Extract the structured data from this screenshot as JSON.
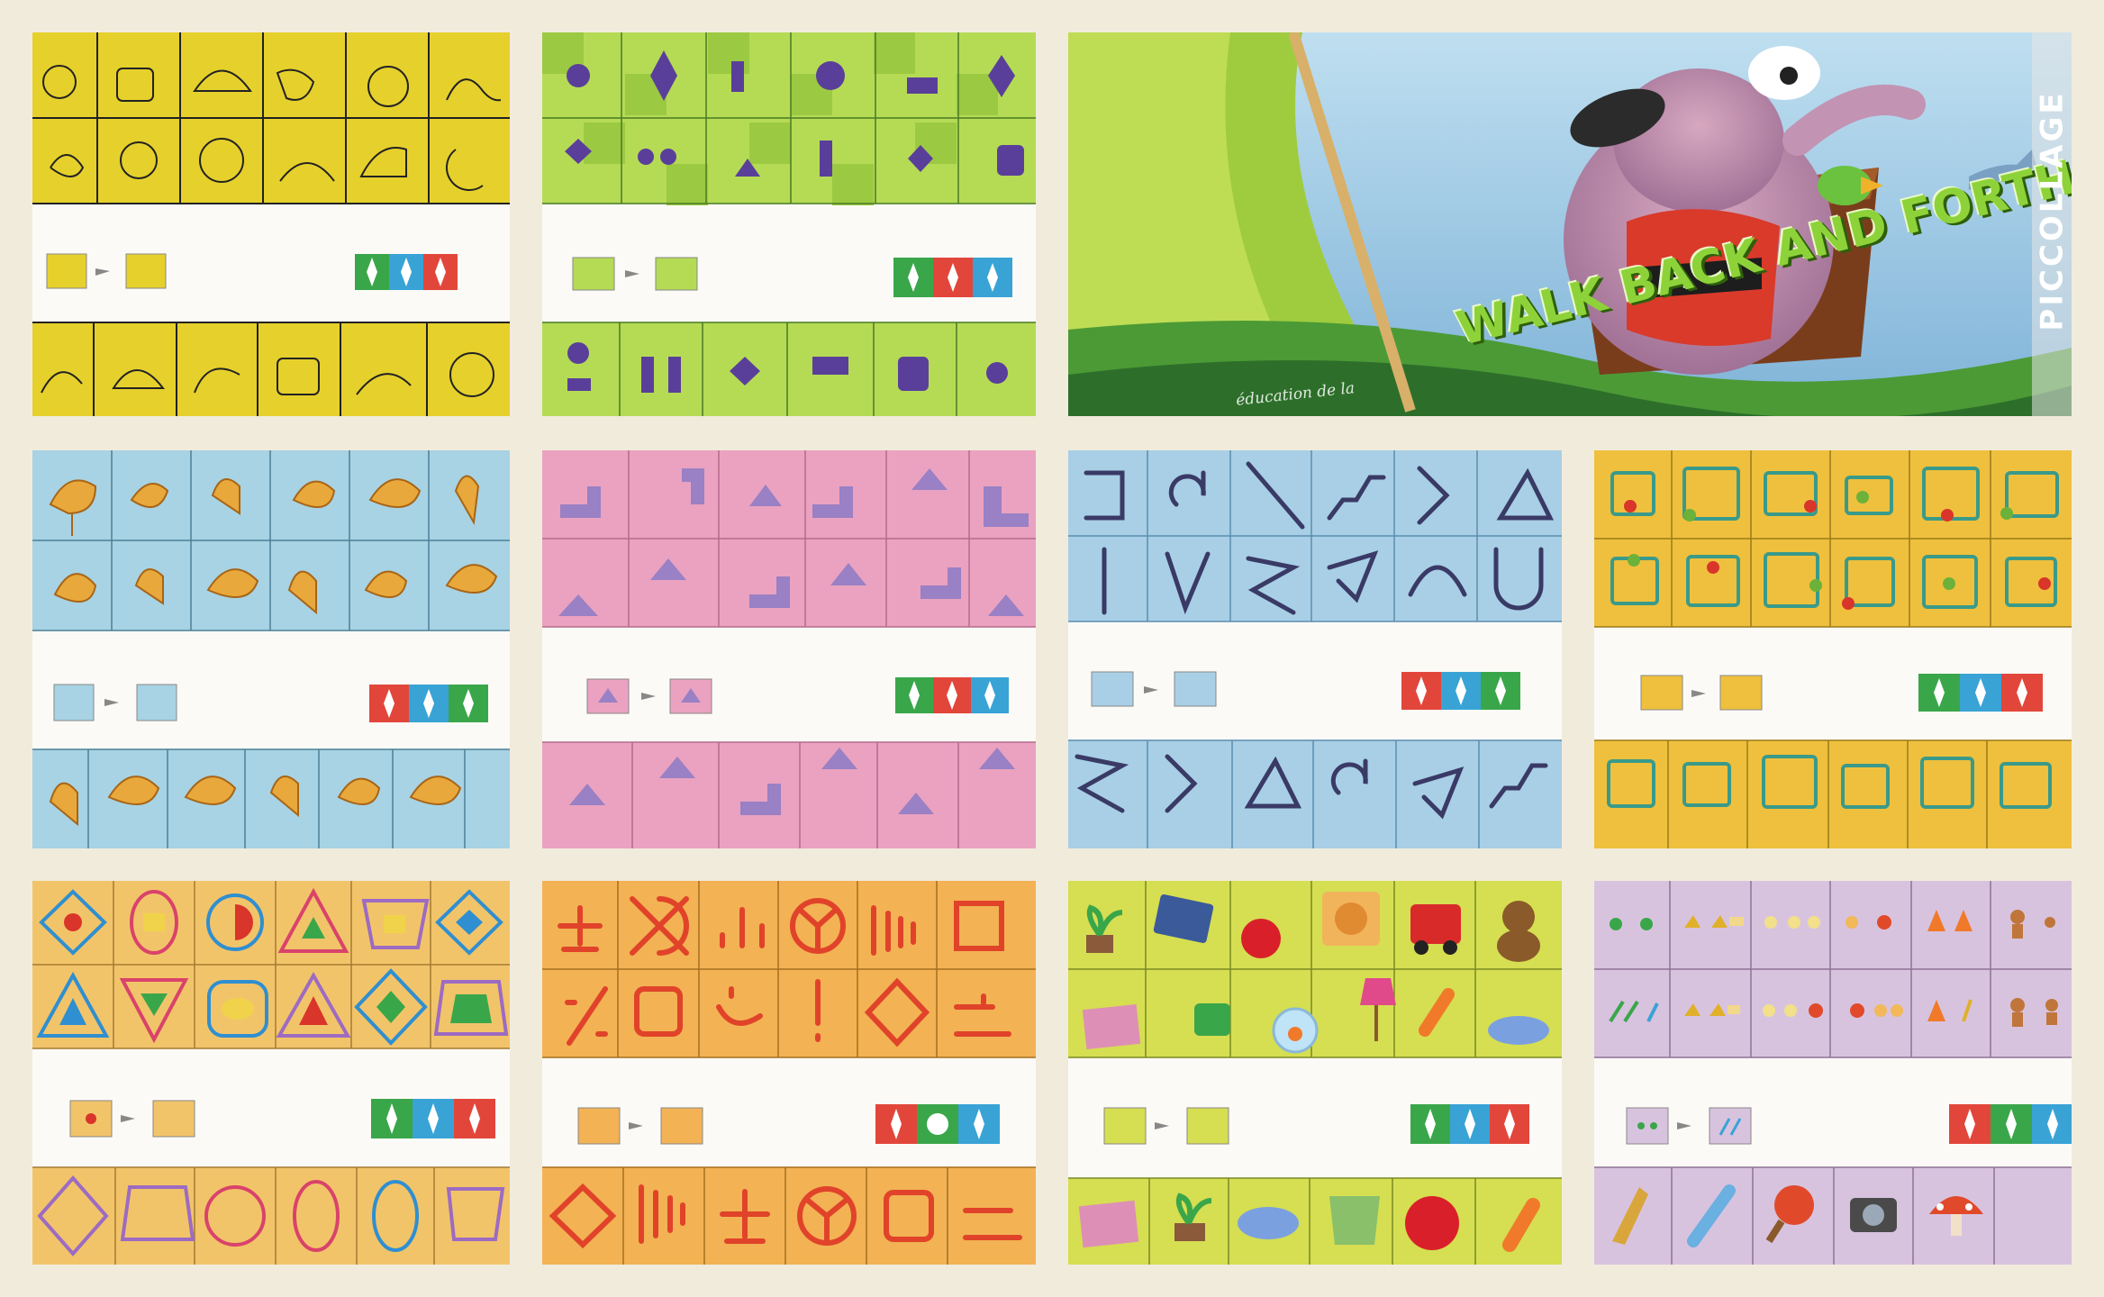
{
  "collage": {
    "cover": {
      "title": "WALK BACK AND FORTH",
      "publisher": "éducation de la",
      "watermark": "PICCOLLAGE"
    },
    "cards": [
      {
        "name": "card-doodles",
        "bg": "#e8d233"
      },
      {
        "name": "card-purple-shapes",
        "bg": "#b8dc58"
      },
      {
        "name": "card-roosters",
        "bg": "#a9d3e3"
      },
      {
        "name": "card-pink-shapes",
        "bg": "#e8a3bf"
      },
      {
        "name": "card-arrows",
        "bg": "#a7cfe6"
      },
      {
        "name": "card-squares-apples",
        "bg": "#efc13f"
      },
      {
        "name": "card-colored-shapes",
        "bg": "#f2c56a"
      },
      {
        "name": "card-red-symbols",
        "bg": "#f3b35a"
      },
      {
        "name": "card-objects",
        "bg": "#d8e055"
      },
      {
        "name": "card-small-items",
        "bg": "#d9c2df"
      }
    ]
  }
}
